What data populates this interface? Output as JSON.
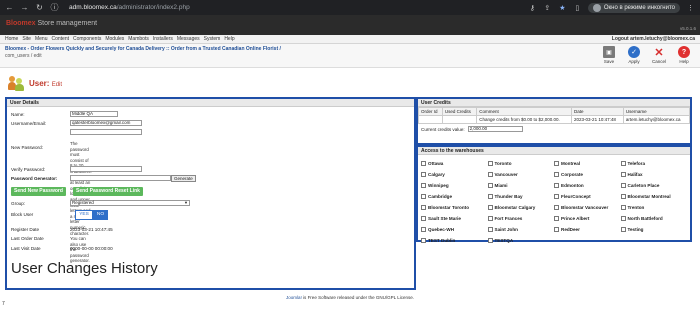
{
  "browser": {
    "url_host": "adm.bloomex.ca",
    "url_path": "/administrator/index2.php",
    "incognito_label": "Окно в режиме инкогнито"
  },
  "admin": {
    "brand": "Bloomex",
    "brand_suffix": "Store management",
    "version": "v5.0.1.6"
  },
  "menu": {
    "items": [
      "Home",
      "Site",
      "Menu",
      "Content",
      "Components",
      "Modules",
      "Mambots",
      "Installers",
      "Messages",
      "System",
      "Help"
    ],
    "logout": "Logout artem.letuchy@bloomex.ca"
  },
  "toolbar": {
    "site_link": "Bloomex - Order Flowers Quickly and Securely for Canada Delivery :: Order from a Trusted Canadian Online Florist /",
    "path": "com_users / edit",
    "save": "Save",
    "apply": "Apply",
    "cancel": "Cancel",
    "help": "Help"
  },
  "page": {
    "title": "User:",
    "subtitle": "Edit"
  },
  "details": {
    "header": "User Details",
    "name_label": "Name:",
    "name_value": "Middle QA",
    "username_label": "Username/Email:",
    "username_value": "qatesterbloomex@gmail.com",
    "new_password_label": "New Password:",
    "password_note_1": "The password must consist of 8 to 20 characters.",
    "password_note_2": "Must have at least an one digit, lowercase and upper case letters and a non-letter numeric character.",
    "password_note_3": "You can also use the password generator.",
    "verify_label": "Verify Password:",
    "generator_label": "Password Generator:",
    "generate_button": "Generate",
    "send_new_password": "Send New Password",
    "send_reset_link": "Send Password Reset Link",
    "group_label": "Group:",
    "group_value": "Registered",
    "block_label": "Block User",
    "yes": "YES",
    "no": "NO",
    "register_label": "Register Date",
    "register_value": "2023-03-21 10:47:45",
    "last_order_label": "Last Order Date",
    "last_visit_label": "Last Visit Date",
    "last_visit_value": "0000-00-00 00:00:00",
    "history_title": "User Changes History"
  },
  "credits": {
    "header": "User Credits",
    "columns": [
      "Order Id",
      "Used Credits",
      "Comment",
      "Date",
      "Username"
    ],
    "rows": [
      [
        "",
        "",
        "Change credits from $0.00 to $2,000.00.",
        "2023-03-21 10:47:48",
        "artem.letuchy@bloomex.ca"
      ]
    ],
    "current_label": "Current credits value:",
    "current_value": "2,000.00"
  },
  "warehouses": {
    "header": "Access to the warehouses",
    "items": [
      "Ottawa",
      "Toronto",
      "Montreal",
      "Telefora",
      "Calgary",
      "Vancouver",
      "Corporate",
      "Halifax",
      "Winnipeg",
      "Miami",
      "Edmonton",
      "Carleton Place",
      "Cambridge",
      "Thunder Bay",
      "FleurConcept",
      "Bloomstar Montreal",
      "Bloomstar Toronto",
      "Bloomstar Calgary",
      "Bloomstar Vancouver",
      "Trenton",
      "Sault Ste Marie",
      "Fort Frances",
      "Prince Albert",
      "North Battleford",
      "Quebec-WH",
      "Saint John",
      "RedDeer",
      "Testing",
      "TEST Dublin",
      "TESTQA"
    ]
  },
  "footer": {
    "joomla": "Joomla!",
    "text": "is Free Software released under the GNU/GPL License."
  },
  "page_number": "7"
}
